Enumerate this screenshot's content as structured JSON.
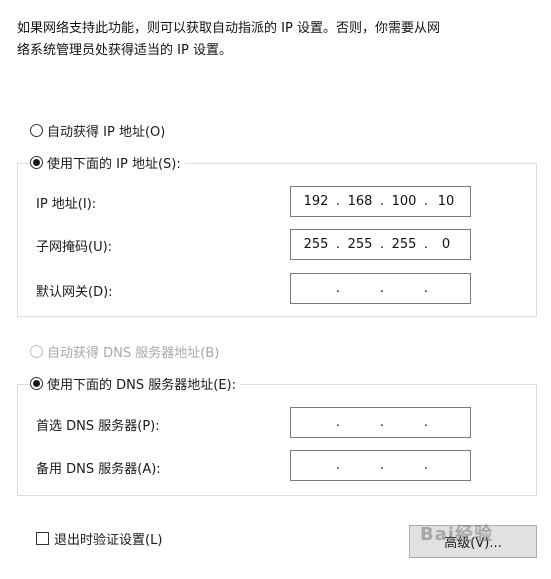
{
  "description_line1": "如果网络支持此功能，则可以获取自动指派的 IP 设置。否则，你需要从网",
  "description_line2": "络系统管理员处获得适当的 IP 设置。",
  "ip_section": {
    "auto_label": "自动获得 IP 地址(O)",
    "manual_label": "使用下面的 IP 地址(S):",
    "selected": "manual",
    "fields": {
      "ip_label": "IP 地址(I):",
      "ip_value": [
        "192",
        "168",
        "100",
        "10"
      ],
      "mask_label": "子网掩码(U):",
      "mask_value": [
        "255",
        "255",
        "255",
        "0"
      ],
      "gateway_label": "默认网关(D):",
      "gateway_value": [
        "",
        "",
        "",
        ""
      ]
    }
  },
  "dns_section": {
    "auto_label": "自动获得 DNS 服务器地址(B)",
    "manual_label": "使用下面的 DNS 服务器地址(E):",
    "selected": "manual",
    "fields": {
      "preferred_label": "首选 DNS 服务器(P):",
      "preferred_value": [
        "",
        "",
        "",
        ""
      ],
      "alternate_label": "备用 DNS 服务器(A):",
      "alternate_value": [
        "",
        "",
        "",
        ""
      ]
    }
  },
  "validate_label": "退出时验证设置(L)",
  "advanced_button": "高级(V)...",
  "watermark": "Bai经验"
}
